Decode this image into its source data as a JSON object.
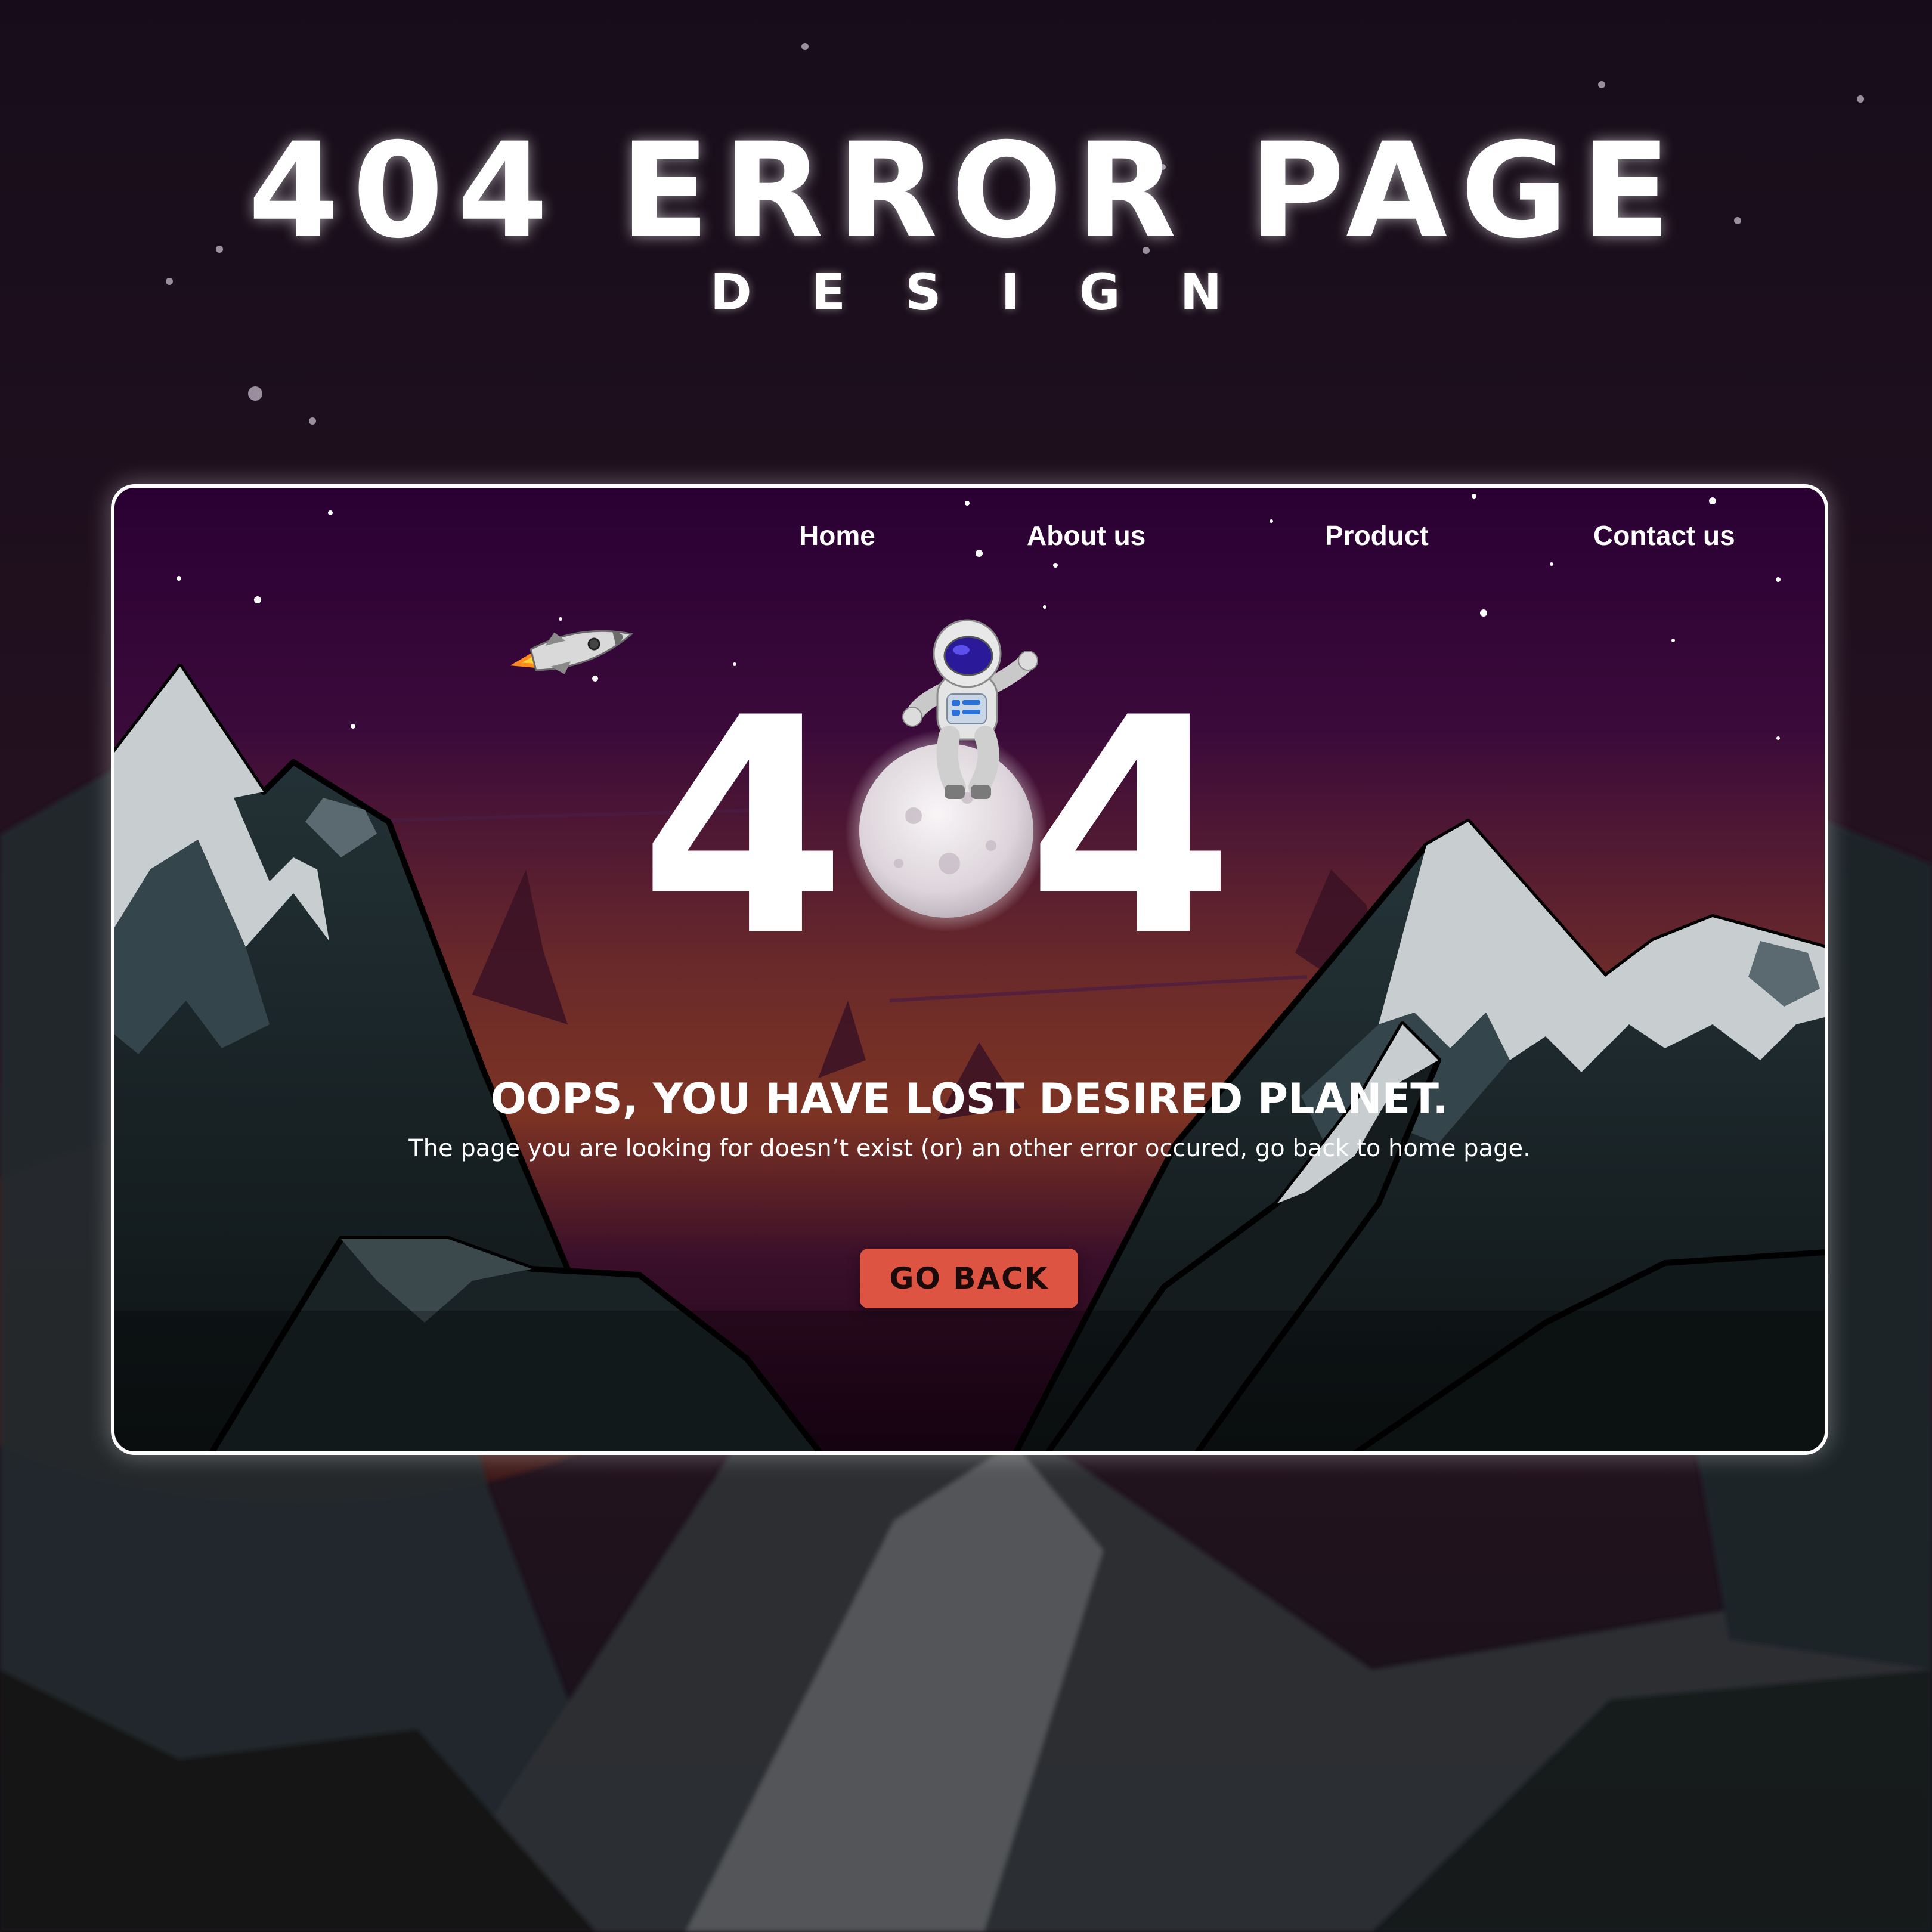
{
  "showcase": {
    "title": "404 ERROR PAGE",
    "subtitle": "DESIGN"
  },
  "nav": {
    "items": [
      {
        "label": "Home"
      },
      {
        "label": "About us"
      },
      {
        "label": "Product"
      },
      {
        "label": "Contact us"
      }
    ]
  },
  "hero": {
    "code_first": "4",
    "code_last": "4",
    "headline": "OOPS, YOU HAVE LOST DESIRED PLANET.",
    "message": "The page you are looking for doesn’t exist (or) an other error occured, go back to home page.",
    "button_label": "GO BACK"
  },
  "colors": {
    "background": "#1b0f1e",
    "sky_top": "#2b0033",
    "sky_bottom": "#7a2e22",
    "mountain": "#1e2a2e",
    "snow": "#c9cfd1",
    "button": "#dd5442",
    "text": "#ffffff"
  },
  "icons": {
    "rocket": "rocket-icon",
    "astronaut": "astronaut-icon",
    "moon": "moon-icon"
  }
}
